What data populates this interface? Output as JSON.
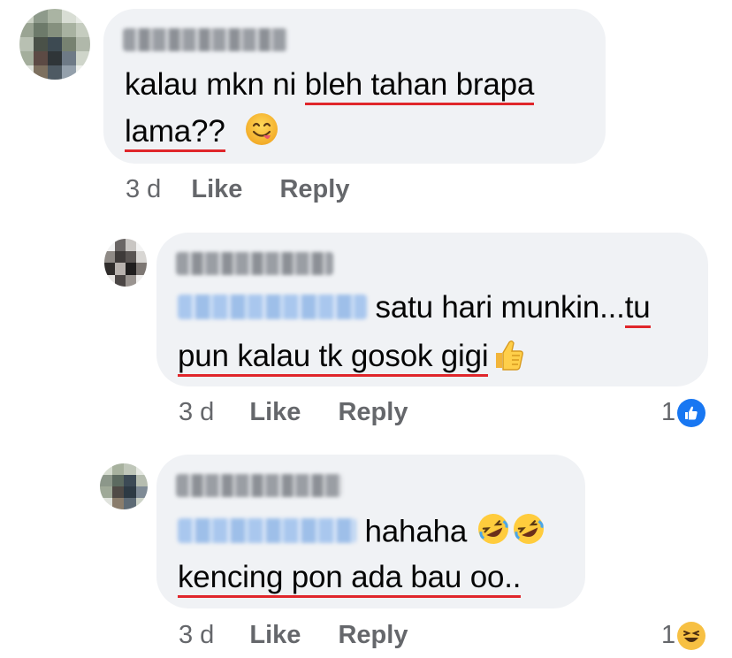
{
  "comments": [
    {
      "author": "Arsh Ahmad",
      "text_line1_pre": "kalau mkn ni ",
      "text_line1_ul": "bleh tahan brapa",
      "text_line2_ul": "lama??",
      "time": "3 d",
      "like_label": "Like",
      "reply_label": "Reply",
      "emoji": "yum-face-icon"
    },
    {
      "author": "Farik Hakim",
      "mention": "Arsh Ahmad",
      "text_line1_pre": " satu hari munkin...",
      "text_line1_ul": "tu",
      "text_line2_ul": "pun kalau tk gosok gigi",
      "time": "3 d",
      "like_label": "Like",
      "reply_label": "Reply",
      "emoji": "thumbs-up-icon",
      "reaction_count": "1",
      "reaction_icon": "like-reaction-icon"
    },
    {
      "author": "Arsh Ahmad",
      "mention": "Farik Hakim",
      "text_line1_pre": " hahaha",
      "text_line2_ul": "kencing pon ada bau oo..",
      "time": "3 d",
      "like_label": "Like",
      "reply_label": "Reply",
      "emoji": "rofl-face-icon",
      "reaction_count": "1",
      "reaction_icon": "haha-reaction-icon"
    }
  ],
  "colors": {
    "bubble": "#f0f2f5",
    "underline": "#e0262b",
    "meta": "#65676b",
    "like_blue": "#1877f2",
    "emoji_yellow": "#f7c043"
  }
}
